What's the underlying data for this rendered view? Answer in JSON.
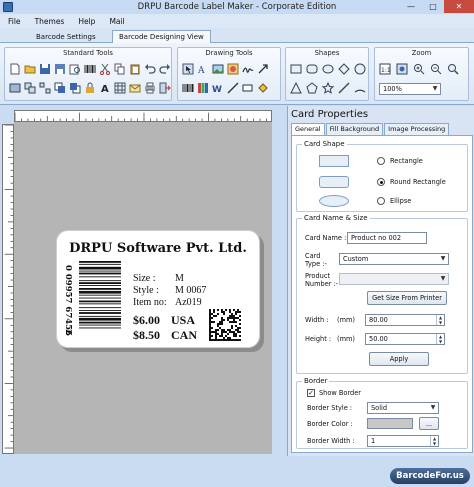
{
  "window": {
    "title": "DRPU Barcode Label Maker - Corporate Edition"
  },
  "menu": [
    "File",
    "Themes",
    "Help",
    "Mail"
  ],
  "ribbon_tabs": [
    {
      "label": "Barcode Settings",
      "active": false
    },
    {
      "label": "Barcode Designing View",
      "active": true
    }
  ],
  "toolbar_groups": {
    "standard": "Standard Tools",
    "drawing": "Drawing Tools",
    "shapes": "Shapes",
    "zoom": "Zoom",
    "zoom_value": "100%"
  },
  "label": {
    "company": "DRPU Software Pvt. Ltd.",
    "barcode_digits_top": "0 09957 67456",
    "barcode_digit_bottom": "2",
    "size_label": "Size  :",
    "size_value": "M",
    "style_label": "Style :",
    "style_value": "M 0067",
    "item_label": "Item no:",
    "item_value": "Az019",
    "price1": "$6.00",
    "cur1": "USA",
    "price2": "$8.50",
    "cur2": "CAN"
  },
  "properties": {
    "title": "Card Properties",
    "tabs": [
      "General",
      "Fill Background",
      "Image Processing"
    ],
    "card_shape": {
      "legend": "Card Shape",
      "options": [
        "Rectangle",
        "Round Rectangle",
        "Ellipse"
      ],
      "selected": "Round Rectangle"
    },
    "name_size": {
      "legend": "Card  Name & Size",
      "card_name_label": "Card Name :",
      "card_name_value": "Product no 002",
      "card_type_label": "Card\nType :-",
      "card_type_value": "Custom",
      "product_number_label": "Product\nNumber :-",
      "get_size_button": "Get Size From Printer",
      "width_label": "Width :",
      "width_unit": "(mm)",
      "width_value": "80.00",
      "height_label": "Height :",
      "height_unit": "(mm)",
      "height_value": "50.00",
      "apply_button": "Apply"
    },
    "border": {
      "legend": "Border",
      "show_border_label": "Show Border",
      "show_border_checked": true,
      "style_label": "Border Style :",
      "style_value": "Solid",
      "color_label": "Border Color :",
      "color_button": "...",
      "width_label": "Border Width :",
      "width_value": "1"
    }
  },
  "watermark": "BarcodeFor.us"
}
